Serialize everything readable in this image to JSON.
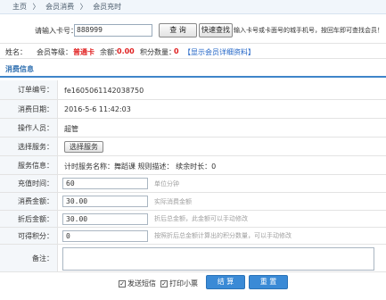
{
  "breadcrumb": [
    "主页",
    "〉",
    "会员消费",
    "〉",
    "会员充时"
  ],
  "card": {
    "label": "请输入卡号：",
    "value": "888999",
    "query_btn": "查  询",
    "fast_btn": "快速查找",
    "hint": "输入卡号或卡面号的城手机号，按回车即可查找会员！"
  },
  "member_info": {
    "name_label": "姓名：",
    "level_label": "会员等级：",
    "level_value": "普通卡",
    "balance_label": "余额：",
    "balance_value": "0.00",
    "points_label": "积分数量：",
    "points_value": "0",
    "detail_link": "【显示会员详细资料】"
  },
  "section_title": "消费信息",
  "form": {
    "order_label": "订单编号：",
    "order_value": "fe1605061142038750",
    "date_label": "消费日期：",
    "date_value": "2016-5-6 11:42:03",
    "operator_label": "操作人员：",
    "operator_value": "超管",
    "service_label": "选择服务：",
    "service_btn": "选择服务",
    "service_info_label": "服务信息：",
    "service_info_value": "计时服务名称：舞蹈课 规则描述： 续余时长：0",
    "recharge_label": "充值时间：",
    "recharge_value": "60",
    "recharge_hint": "单位分钟",
    "amount_label": "消费金额：",
    "amount_value": "30.00",
    "amount_hint": "实际消费金额",
    "discount_label": "折后金额：",
    "discount_value": "30.00",
    "discount_hint": "折后总金额，此金额可以手动修改",
    "points_label": "可得积分：",
    "points_value": "0",
    "points_hint": "按照折后总金额计算出的积分数量，可以手动修改",
    "remark_label": "备注："
  },
  "bottom": {
    "sms_label": "发送短信",
    "print_label": "打印小票",
    "settle_btn": "结  算",
    "reset_btn": "重  置"
  },
  "colors": {
    "accent": "#3a8ad6",
    "red": "#e02020",
    "link": "#1f63c6"
  }
}
